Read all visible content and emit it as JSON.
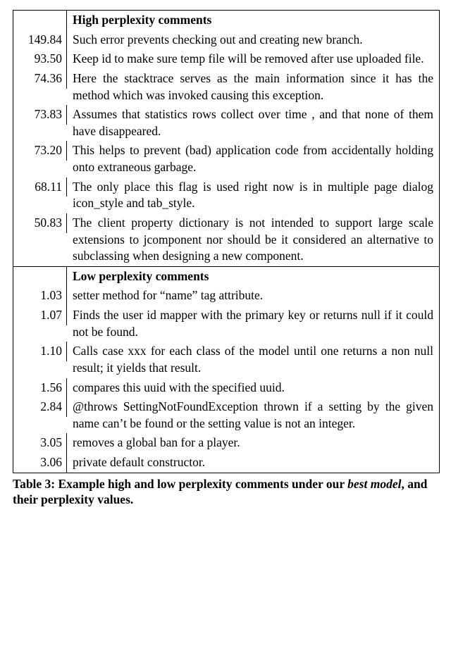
{
  "table": {
    "sections": [
      {
        "header": "High perplexity comments",
        "rows": [
          {
            "value": "149.84",
            "text": "Such error prevents checking out and creating new branch."
          },
          {
            "value": "93.50",
            "text": "Keep id to make sure temp file will be removed after use uploaded file."
          },
          {
            "value": "74.36",
            "text": "Here the stacktrace serves as the main information since it has the method which was invoked causing this exception."
          },
          {
            "value": "73.83",
            "text": "Assumes that statistics rows collect over time , and that none of them have disappeared."
          },
          {
            "value": "73.20",
            "text": "This helps to prevent (bad) application code from accidentally holding onto extraneous garbage."
          },
          {
            "value": "68.11",
            "text": "The only place this flag is used right now is in multiple page dialog icon_style and tab_style."
          },
          {
            "value": "50.83",
            "text": "The client property dictionary is not intended to support large scale extensions to jcomponent nor should be it considered an alternative to subclassing when designing a new component."
          }
        ]
      },
      {
        "header": "Low perplexity comments",
        "rows": [
          {
            "value": "1.03",
            "text": "setter method for “name” tag attribute."
          },
          {
            "value": "1.07",
            "text": "Finds the user id mapper with the primary key or returns null if it could not be found."
          },
          {
            "value": "1.10",
            "text": "Calls case xxx for each class of the model until one returns a non null result; it yields that result."
          },
          {
            "value": "1.56",
            "text": "compares this uuid with the specified uuid."
          },
          {
            "value": "2.84",
            "text": "@throws SettingNotFoundException thrown if a setting by the given name can’t be found or the setting value is not an integer."
          },
          {
            "value": "3.05",
            "text": "removes a global ban for a player."
          },
          {
            "value": "3.06",
            "text": "private default constructor."
          }
        ]
      }
    ]
  },
  "caption": {
    "prefix": "Table 3: Example high and low perplexity comments under our ",
    "italic": "best model",
    "suffix": ", and their perplexity values."
  }
}
